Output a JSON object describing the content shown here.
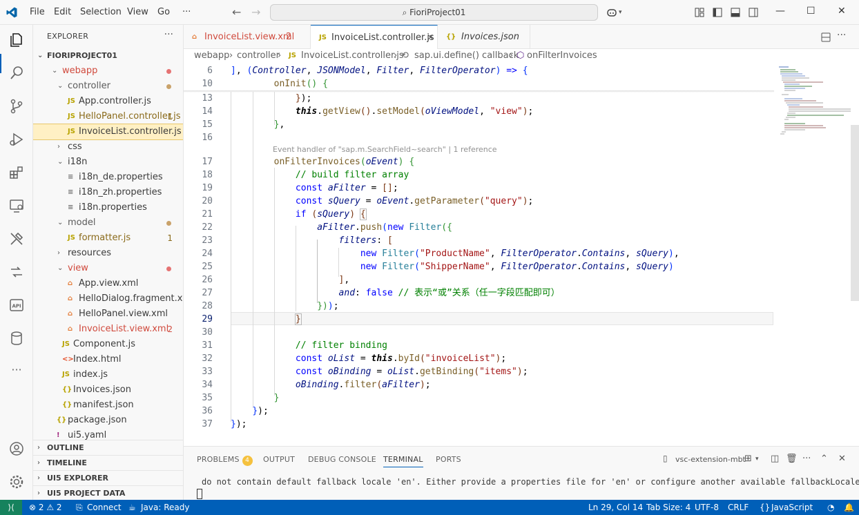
{
  "titlebar": {
    "menu": [
      "File",
      "Edit",
      "Selection",
      "View",
      "Go"
    ],
    "more": "···",
    "search": "FioriProject01"
  },
  "sidebar": {
    "title": "EXPLORER",
    "more": "···",
    "root": "FIORIPROJECT01",
    "items": [
      {
        "label": "webapp",
        "type": "folder",
        "open": true,
        "indent": 0,
        "color": "#d04a3d",
        "dot": "#e57373"
      },
      {
        "label": "controller",
        "type": "folder",
        "open": true,
        "indent": 1,
        "color": "#5b5b5b",
        "dot": "#c9a26a"
      },
      {
        "label": "App.controller.js",
        "type": "js",
        "indent": 2,
        "color": "#3b3b3b"
      },
      {
        "label": "HelloPanel.controller.js",
        "type": "js",
        "indent": 2,
        "color": "#8a6a1a",
        "badge": "1"
      },
      {
        "label": "InvoiceList.controller.js",
        "type": "js",
        "indent": 2,
        "color": "#3b3b3b",
        "selected": true
      },
      {
        "label": "css",
        "type": "folder",
        "open": false,
        "indent": 1,
        "color": "#3b3b3b"
      },
      {
        "label": "i18n",
        "type": "folder",
        "open": true,
        "indent": 1,
        "color": "#3b3b3b"
      },
      {
        "label": "i18n_de.properties",
        "type": "props",
        "indent": 2,
        "color": "#3b3b3b"
      },
      {
        "label": "i18n_zh.properties",
        "type": "props",
        "indent": 2,
        "color": "#3b3b3b"
      },
      {
        "label": "i18n.properties",
        "type": "props",
        "indent": 2,
        "color": "#3b3b3b"
      },
      {
        "label": "model",
        "type": "folder",
        "open": true,
        "indent": 1,
        "color": "#5b5b5b",
        "dot": "#c9a26a"
      },
      {
        "label": "formatter.js",
        "type": "js",
        "indent": 2,
        "color": "#8a6a1a",
        "badge": "1"
      },
      {
        "label": "resources",
        "type": "folder",
        "open": false,
        "indent": 1,
        "color": "#3b3b3b"
      },
      {
        "label": "view",
        "type": "folder",
        "open": true,
        "indent": 1,
        "color": "#d04a3d",
        "dot": "#e57373"
      },
      {
        "label": "App.view.xml",
        "type": "xml",
        "indent": 2,
        "color": "#3b3b3b"
      },
      {
        "label": "HelloDialog.fragment.xml",
        "type": "xml",
        "indent": 2,
        "color": "#3b3b3b"
      },
      {
        "label": "HelloPanel.view.xml",
        "type": "xml",
        "indent": 2,
        "color": "#3b3b3b"
      },
      {
        "label": "InvoiceList.view.xml",
        "type": "xml",
        "indent": 2,
        "color": "#d04a3d",
        "badge": "2",
        "badgeColor": "#d04a3d"
      },
      {
        "label": "Component.js",
        "type": "js",
        "indent": 1,
        "color": "#3b3b3b"
      },
      {
        "label": "Index.html",
        "type": "html",
        "indent": 1,
        "color": "#3b3b3b"
      },
      {
        "label": "index.js",
        "type": "js",
        "indent": 1,
        "color": "#3b3b3b"
      },
      {
        "label": "Invoices.json",
        "type": "json",
        "indent": 1,
        "color": "#3b3b3b"
      },
      {
        "label": "manifest.json",
        "type": "json",
        "indent": 1,
        "color": "#3b3b3b"
      },
      {
        "label": "package.json",
        "type": "json",
        "indent": 0,
        "color": "#3b3b3b"
      },
      {
        "label": "ui5.yaml",
        "type": "yaml",
        "indent": 0,
        "color": "#3b3b3b"
      }
    ],
    "sections": [
      "OUTLINE",
      "TIMELINE",
      "UI5 EXPLORER",
      "UI5 PROJECT DATA"
    ]
  },
  "tabs": [
    {
      "label": "InvoiceList.view.xml",
      "badge": "2",
      "icon": "xml-file-icon",
      "color": "#d04a3d"
    },
    {
      "label": "InvoiceList.controller.js",
      "close": "×",
      "icon": "js-file-icon",
      "color": "#3b3b3b",
      "active": true
    },
    {
      "label": "Invoices.json",
      "icon": "json-file-icon",
      "color": "#3b3b3b",
      "italic": true
    }
  ],
  "breadcrumb": [
    "webapp",
    "controller",
    "InvoiceList.controller.js",
    "sap.ui.define() callback",
    "onFilterInvoices"
  ],
  "editor": {
    "codelens": "Event handler of \"sap.m.SearchField~search\" | 1 reference",
    "lines": [
      {
        "n": "6"
      },
      {
        "n": "10"
      },
      {
        "n": "13"
      },
      {
        "n": "14"
      },
      {
        "n": "15"
      },
      {
        "n": "16"
      },
      {
        "n": "17"
      },
      {
        "n": "18"
      },
      {
        "n": "19"
      },
      {
        "n": "20"
      },
      {
        "n": "21"
      },
      {
        "n": "22"
      },
      {
        "n": "23"
      },
      {
        "n": "24"
      },
      {
        "n": "25"
      },
      {
        "n": "26"
      },
      {
        "n": "27"
      },
      {
        "n": "28"
      },
      {
        "n": "29"
      },
      {
        "n": "30"
      },
      {
        "n": "31"
      },
      {
        "n": "32"
      },
      {
        "n": "33"
      },
      {
        "n": "34"
      },
      {
        "n": "35"
      },
      {
        "n": "36"
      },
      {
        "n": "37"
      }
    ],
    "comment_note": "// 表示“或”关系（任一字段匹配即可）"
  },
  "panel": {
    "tabs": [
      "PROBLEMS",
      "OUTPUT",
      "DEBUG CONSOLE",
      "TERMINAL",
      "PORTS"
    ],
    "problems_count": "4",
    "terminal_name": "vsc-extension-mbt",
    "terminal_text": "do not contain default fallback locale 'en'. Either provide a properties file for 'en' or configure another available fallbackLocale"
  },
  "statusbar": {
    "problems": "⊗ 2 ⚠ 2",
    "connect": "Connect",
    "java": "Java: Ready",
    "position": "Ln 29, Col 14",
    "tabsize": "Tab Size: 4",
    "encoding": "UTF-8",
    "eol": "CRLF",
    "language": "JavaScript",
    "braces": "{}"
  },
  "colors": {
    "accent": "#005fb8",
    "statusbar": "#005fb8",
    "remote": "#16825d",
    "selection": "#fff0c4"
  }
}
